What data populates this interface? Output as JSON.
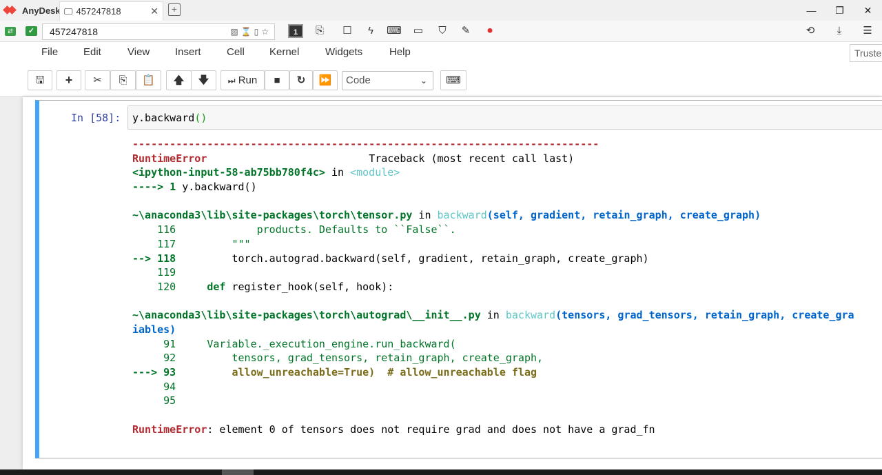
{
  "anydesk": {
    "brand": "AnyDesk",
    "tab_title": "457247818",
    "address": "457247818",
    "window_controls": [
      "minimize-icon",
      "maximize-icon",
      "close-icon"
    ]
  },
  "menu": {
    "items": [
      "File",
      "Edit",
      "View",
      "Insert",
      "Cell",
      "Kernel",
      "Widgets",
      "Help"
    ],
    "trusted": "Truste"
  },
  "toolbar": {
    "run_label": "Run",
    "cell_type": "Code"
  },
  "cell": {
    "prompt": "In [58]:",
    "code_prefix": "y.backward",
    "code_paren": "()"
  },
  "output": {
    "dashes": "---------------------------------------------------------------------------",
    "error_name": "RuntimeError",
    "traceback_label": "Traceback (most recent call last)",
    "input_ref": "<ipython-input-58-ab75bb780f4c>",
    "in_word": "in",
    "module": "<module>",
    "arrow1": "----> 1 ",
    "arrow1_code": "y.backward()",
    "frame1_path": "~\\anaconda3\\lib\\site-packages\\torch\\tensor.py",
    "frame1_func": "backward",
    "frame1_args": "(self, gradient, retain_graph, create_graph)",
    "f1_l116": "    116             products. Defaults to ``False``.",
    "f1_l117": "    117         \"\"\"",
    "f1_arrow": "--> 118",
    "f1_l118_code": "         torch.autograd.backward(self, gradient, retain_graph, create_graph)",
    "f1_l119": "    119",
    "f1_l120_num": "    120",
    "f1_l120_kw": "def",
    "f1_l120_code": " register_hook(self, hook):",
    "frame2_path": "~\\anaconda3\\lib\\site-packages\\torch\\autograd\\__init__.py",
    "frame2_func": "backward",
    "frame2_args": "(tensors, grad_tensors, retain_graph, create_gra",
    "frame2_wrap": "iables)",
    "f2_l91": "     91     Variable._execution_engine.run_backward(",
    "f2_l92": "     92         tensors, grad_tensors, retain_graph, create_graph,",
    "f2_arrow": "---> 93",
    "f2_l93_code": "allow_unreachable=True)  # allow_unreachable flag",
    "f2_l94": "     94",
    "f2_l95": "     95",
    "final_error": "RuntimeError",
    "final_msg": ": element 0 of tensors does not require grad and does not have a grad_fn"
  }
}
